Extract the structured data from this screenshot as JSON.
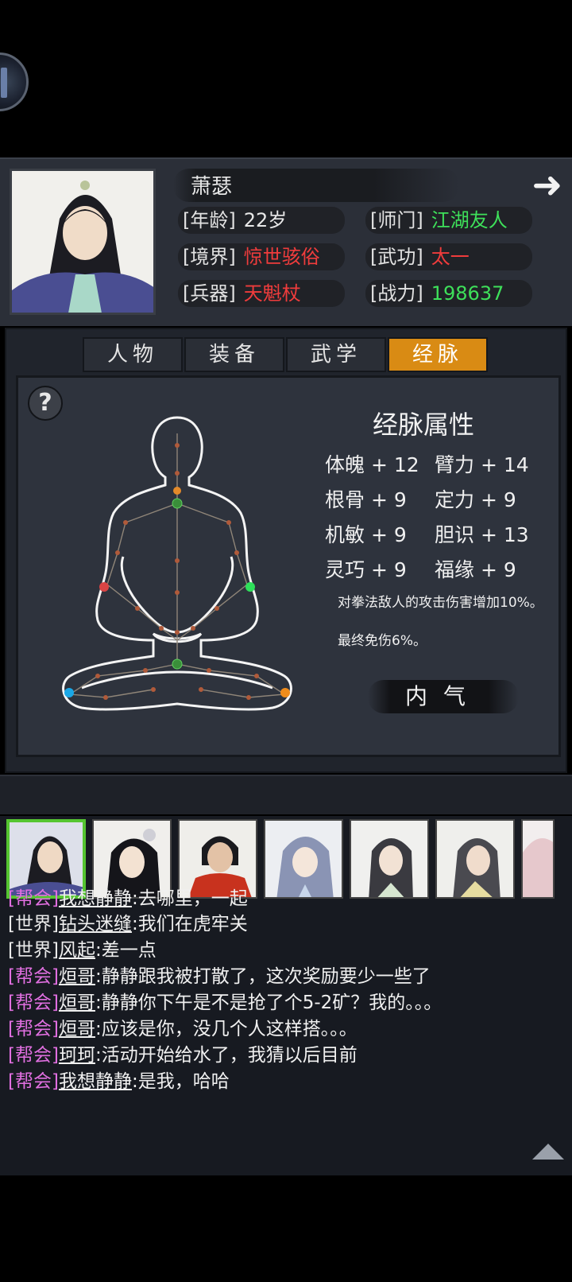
{
  "character": {
    "name": "萧瑟",
    "stats": [
      {
        "label": "[年龄]",
        "value": "22岁",
        "color": "#e8e8e8"
      },
      {
        "label": "[师门]",
        "value": "江湖友人",
        "color": "#3ee05a"
      },
      {
        "label": "[境界]",
        "value": "惊世骇俗",
        "color": "#f03c3c"
      },
      {
        "label": "[武功]",
        "value": "太一",
        "color": "#f03c3c"
      },
      {
        "label": "[兵器]",
        "value": "天魁杖",
        "color": "#f03c3c"
      },
      {
        "label": "[战力]",
        "value": "198637",
        "color": "#3ee05a"
      }
    ]
  },
  "tabs": [
    {
      "label": "人物",
      "active": false
    },
    {
      "label": "装备",
      "active": false
    },
    {
      "label": "武学",
      "active": false
    },
    {
      "label": "经脉",
      "active": true
    }
  ],
  "meridian": {
    "title": "经脉属性",
    "attributes": [
      {
        "name": "体魄",
        "value": "+ 12"
      },
      {
        "name": "臂力",
        "value": "+ 14"
      },
      {
        "name": "根骨",
        "value": "+ 9"
      },
      {
        "name": "定力",
        "value": "+ 9"
      },
      {
        "name": "机敏",
        "value": "+ 9"
      },
      {
        "name": "胆识",
        "value": "+ 13"
      },
      {
        "name": "灵巧",
        "value": "+ 9"
      },
      {
        "name": "福缘",
        "value": "+ 9"
      }
    ],
    "effects": [
      "对拳法敌人的攻击伤害增加10%。",
      "最终免伤6%。"
    ],
    "button": "内气"
  },
  "chat": {
    "messages": [
      {
        "channel": "[帮会]",
        "user": "我想静静",
        "text": ":去哪里，一起",
        "type": "guild"
      },
      {
        "channel": "[世界]",
        "user": "钻头迷缝",
        "text": ":我们在虎牢关",
        "type": "world"
      },
      {
        "channel": "[世界]",
        "user": "风起",
        "text": ":差一点",
        "type": "world"
      },
      {
        "channel": "[帮会]",
        "user": "烜哥",
        "text": ":静静跟我被打散了，这次奖励要少一些了",
        "type": "guild"
      },
      {
        "channel": "[帮会]",
        "user": "烜哥",
        "text": ":静静你下午是不是抢了个5-2矿？我的。。。",
        "type": "guild"
      },
      {
        "channel": "[帮会]",
        "user": "烜哥",
        "text": ":应该是你，没几个人这样搭。。。",
        "type": "guild"
      },
      {
        "channel": "[帮会]",
        "user": "珂珂",
        "text": ":活动开始给水了，我猜以后目前",
        "type": "guild"
      },
      {
        "channel": "[帮会]",
        "user": "我想静静",
        "text": ":是我，哈哈",
        "type": "guild"
      }
    ]
  },
  "colors": {
    "accent": "#d98b14",
    "green": "#3ee05a",
    "red": "#f03c3c",
    "guild": "#e06fe0"
  }
}
